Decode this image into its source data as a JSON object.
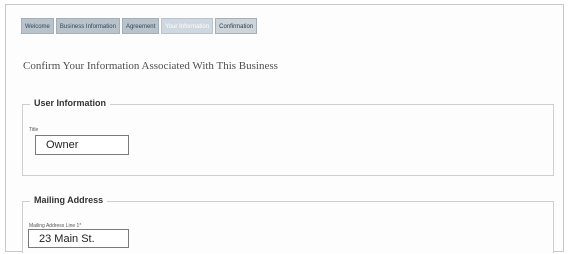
{
  "wizard": {
    "tabs": [
      {
        "label": "Welcome"
      },
      {
        "label": "Business Information"
      },
      {
        "label": "Agreement"
      },
      {
        "label": "Your Information"
      },
      {
        "label": "Confirmation"
      }
    ],
    "active_index": 3
  },
  "page": {
    "title": "Confirm Your Information Associated With This Business"
  },
  "user_information": {
    "legend": "User Information",
    "title_label": "Title",
    "title_value": "Owner"
  },
  "mailing_address": {
    "legend": "Mailing Address",
    "line1_label": "Mailing Address Line 1*",
    "line1_value": "23 Main St."
  }
}
